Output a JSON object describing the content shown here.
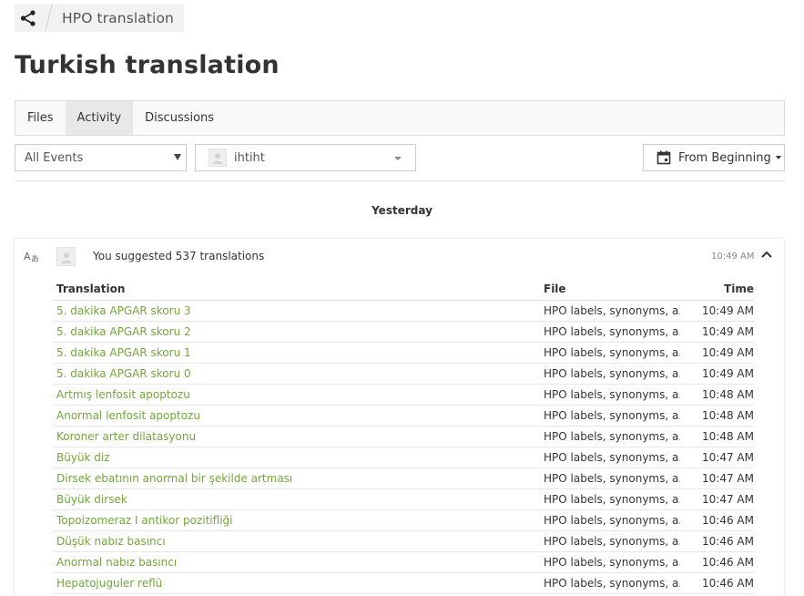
{
  "breadcrumb": {
    "project": "HPO translation"
  },
  "page": {
    "title": "Turkish translation"
  },
  "tabs": [
    {
      "label": "Files",
      "active": false
    },
    {
      "label": "Activity",
      "active": true
    },
    {
      "label": "Discussions",
      "active": false
    }
  ],
  "filters": {
    "events_label": "All Events",
    "user_label": "ihtiht",
    "date_label": "From Beginning"
  },
  "activity": {
    "day_header": "Yesterday",
    "summary": "You suggested 537 translations",
    "time": "10:49 AM",
    "table": {
      "headers": {
        "translation": "Translation",
        "file": "File",
        "time": "Time"
      },
      "rows": [
        {
          "translation": "5. dakika APGAR skoru 3",
          "file": "HPO labels, synonyms, a...",
          "time": "10:49 AM"
        },
        {
          "translation": "5. dakika APGAR skoru 2",
          "file": "HPO labels, synonyms, a...",
          "time": "10:49 AM"
        },
        {
          "translation": "5. dakika APGAR skoru 1",
          "file": "HPO labels, synonyms, a...",
          "time": "10:49 AM"
        },
        {
          "translation": "5. dakika APGAR skoru 0",
          "file": "HPO labels, synonyms, a...",
          "time": "10:49 AM"
        },
        {
          "translation": "Artmış lenfosit apoptozu",
          "file": "HPO labels, synonyms, a...",
          "time": "10:48 AM"
        },
        {
          "translation": "Anormal lenfosit apoptozu",
          "file": "HPO labels, synonyms, a...",
          "time": "10:48 AM"
        },
        {
          "translation": "Koroner arter dilatasyonu",
          "file": "HPO labels, synonyms, a...",
          "time": "10:48 AM"
        },
        {
          "translation": "Büyük diz",
          "file": "HPO labels, synonyms, a...",
          "time": "10:47 AM"
        },
        {
          "translation": "Dirsek ebatının anormal bir şekilde artması",
          "file": "HPO labels, synonyms, a...",
          "time": "10:47 AM"
        },
        {
          "translation": "Büyük dirsek",
          "file": "HPO labels, synonyms, a...",
          "time": "10:47 AM"
        },
        {
          "translation": "Topoizomeraz I antikor pozitifliği",
          "file": "HPO labels, synonyms, a...",
          "time": "10:46 AM"
        },
        {
          "translation": "Düşük nabız basıncı",
          "file": "HPO labels, synonyms, a...",
          "time": "10:46 AM"
        },
        {
          "translation": "Anormal nabız basıncı",
          "file": "HPO labels, synonyms, a...",
          "time": "10:46 AM"
        },
        {
          "translation": "Hepatojuguler reflü",
          "file": "HPO labels, synonyms, a...",
          "time": "10:46 AM"
        }
      ]
    }
  },
  "icons": {
    "share": "share-icon",
    "translate": "translate-icon",
    "calendar": "calendar-icon",
    "collapse": "chevron-up-icon",
    "avatar": "user-avatar-icon"
  },
  "colors": {
    "link_green": "#73a63c",
    "tab_active_bg": "#e8e8e8"
  }
}
